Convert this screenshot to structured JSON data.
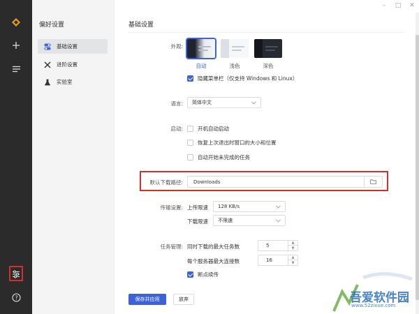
{
  "iconbar": {
    "items": [
      "logo-icon",
      "add-icon",
      "menu-lines-icon"
    ],
    "bottom": [
      "settings-sliders-icon",
      "help-icon"
    ],
    "highlight_color": "#d32f2f"
  },
  "sidepanel": {
    "title": "偏好设置",
    "nav": [
      {
        "label": "基础设置",
        "icon": "toggle-icon",
        "active": true
      },
      {
        "label": "进阶设置",
        "icon": "tools-icon",
        "active": false
      },
      {
        "label": "实验室",
        "icon": "flask-icon",
        "active": false
      }
    ]
  },
  "window": {
    "controls": [
      "–",
      "□",
      "✕"
    ]
  },
  "main": {
    "title": "基础设置",
    "appearance": {
      "label": "外观:",
      "options": [
        "自动",
        "浅色",
        "深色"
      ],
      "selected": "自动",
      "hide_menubar_label": "隐藏菜单栏（仅支持 Windows 和 Linux）",
      "hide_menubar_checked": true
    },
    "language": {
      "label": "语言:",
      "value": "简体中文"
    },
    "startup": {
      "label": "启动:",
      "options": [
        {
          "label": "开机自动启动",
          "checked": false
        },
        {
          "label": "恢复上次退出时窗口的大小和位置",
          "checked": false
        },
        {
          "label": "自动开始未完成的任务",
          "checked": false
        }
      ]
    },
    "download_path": {
      "label": "默认下载路径:",
      "value": "Downloads"
    },
    "transfer": {
      "label": "传输设置:",
      "upload_label": "上传限速",
      "upload_value": "128 KB/s",
      "download_label": "下载限速",
      "download_value": "不限速"
    },
    "tasks": {
      "label": "任务管理:",
      "max_tasks_label": "同时下载的最大任务数",
      "max_tasks_value": "5",
      "max_conn_label": "每个服务器最大连接数",
      "max_conn_value": "16",
      "resume_label": "断点续传",
      "resume_checked": true
    },
    "buttons": {
      "save": "保存并应用",
      "discard": "放弃"
    },
    "accent_color": "#3b63d9"
  },
  "watermark": {
    "text": "吾爱软件园",
    "url": "www.52zixue.com"
  }
}
